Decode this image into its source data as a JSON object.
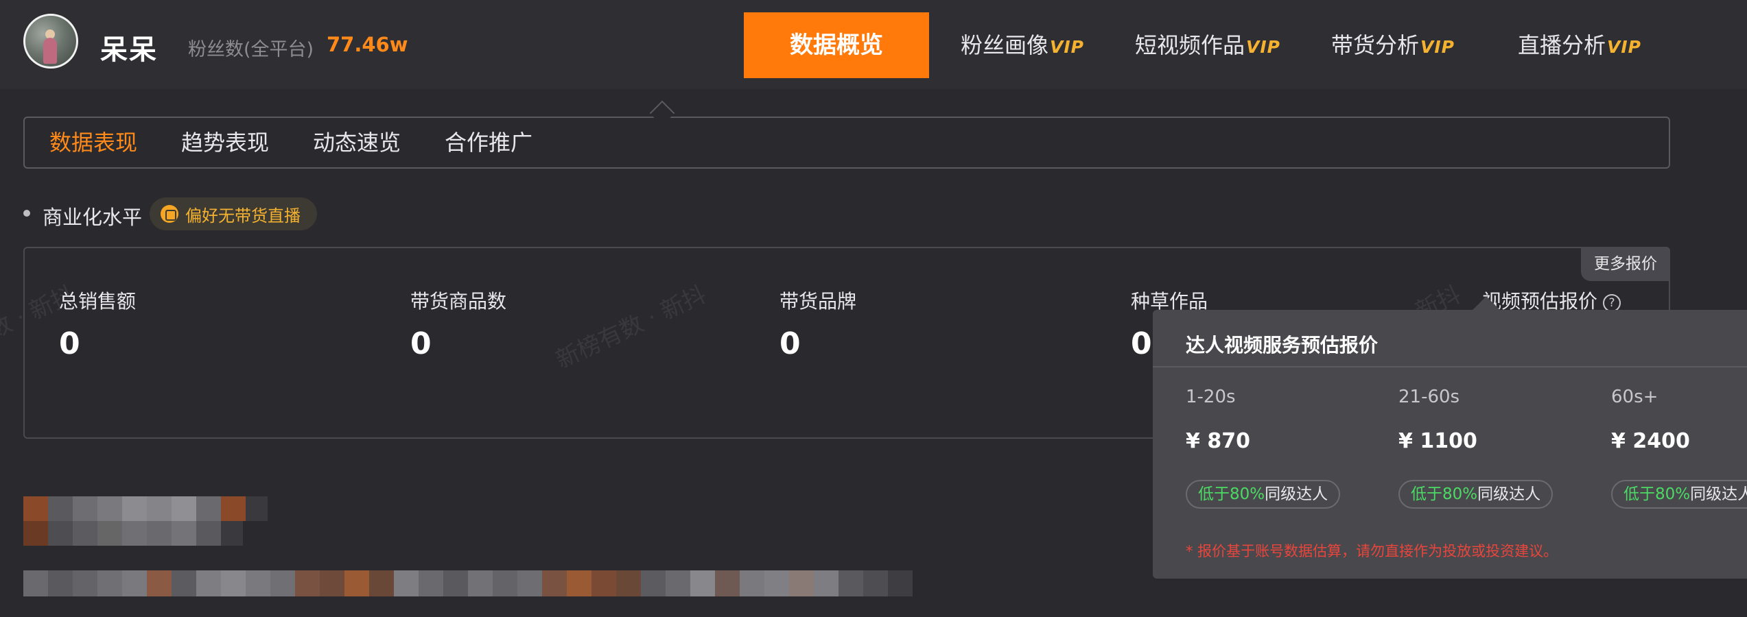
{
  "header": {
    "nickname": "呆呆",
    "fans_label": "粉丝数(全平台)",
    "fans_value": "77.46w",
    "nav": [
      {
        "label": "数据概览",
        "vip": ""
      },
      {
        "label": "粉丝画像",
        "vip": "VIP"
      },
      {
        "label": "短视频作品",
        "vip": "VIP"
      },
      {
        "label": "带货分析",
        "vip": "VIP"
      },
      {
        "label": "直播分析",
        "vip": "VIP"
      }
    ],
    "active_nav": "数据概览"
  },
  "subtabs": [
    "数据表现",
    "趋势表现",
    "动态速览",
    "合作推广"
  ],
  "active_subtab": "数据表现",
  "commercial": {
    "title": "商业化水平",
    "badge": "偏好无带货直播"
  },
  "stats": {
    "more_button": "更多报价",
    "items": [
      {
        "label": "总销售额",
        "value": "0"
      },
      {
        "label": "带货商品数",
        "value": "0"
      },
      {
        "label": "带货品牌",
        "value": "0"
      },
      {
        "label": "种草作品",
        "value": "0"
      },
      {
        "label": "视频预估报价",
        "value": ""
      }
    ],
    "help_icon": "?"
  },
  "watermark": "新榜有数 · 新抖",
  "popover": {
    "title": "达人视频服务预估报价",
    "tiers": [
      {
        "range": "1-20s",
        "price": "¥ 870",
        "badge_green": "低于80%",
        "badge_text": "同级达人"
      },
      {
        "range": "21-60s",
        "price": "¥ 1100",
        "badge_green": "低于80%",
        "badge_text": "同级达人"
      },
      {
        "range": "60s+",
        "price": "¥ 2400",
        "badge_green": "低于80%",
        "badge_text": "同级达人"
      }
    ],
    "note": "* 报价基于账号数据估算，请勿直接作为投放或投资建议。"
  },
  "colors": {
    "accent": "#ff7a0a",
    "vip": "#f5b230",
    "positive": "#4cd964",
    "warning": "#e8463c"
  }
}
